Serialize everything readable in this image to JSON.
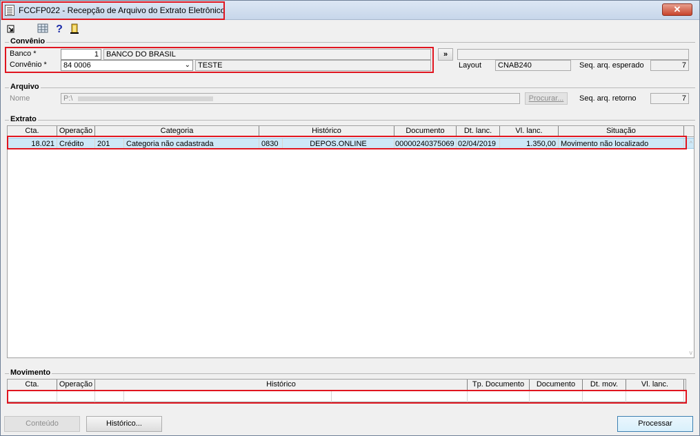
{
  "window": {
    "title": "FCCFP022 - Recepção de Arquivo do Extrato Eletrônico",
    "close_label": "✕"
  },
  "toolbar": {
    "items": [
      "exit-icon",
      "calculator-icon",
      "help-icon",
      "door-exit-icon"
    ]
  },
  "convenio": {
    "group_label": "Convênio",
    "banco_label": "Banco *",
    "banco_value": "1",
    "banco_name": "BANCO DO BRASIL",
    "convenio_label": "Convênio *",
    "convenio_value": "84           0006",
    "convenio_desc": "TESTE",
    "expand_button": "»",
    "layout_label": "Layout",
    "layout_value": "CNAB240",
    "seq_esperado_label": "Seq. arq. esperado",
    "seq_esperado_value": "7"
  },
  "arquivo": {
    "group_label": "Arquivo",
    "nome_label": "Nome",
    "nome_value": "P:\\",
    "procurar_button": "Procurar...",
    "seq_retorno_label": "Seq. arq. retorno",
    "seq_retorno_value": "7"
  },
  "extrato": {
    "group_label": "Extrato",
    "columns": [
      "Cta.",
      "Operação",
      "Categoria",
      "Histórico",
      "Documento",
      "Dt. lanc.",
      "Vl. lanc.",
      "Situação"
    ],
    "rows": [
      {
        "cta": "18.021",
        "operacao": "Crédito",
        "cat_code": "201",
        "categoria": "Categoria não cadastrada",
        "hist_code": "0830",
        "historico": "DEPOS.ONLINE",
        "documento": "00000240375069",
        "dt_lanc": "02/04/2019",
        "vl_lanc": "1.350,00",
        "situacao": "Movimento não localizado"
      }
    ]
  },
  "movimento": {
    "group_label": "Movimento",
    "columns": [
      "Cta.",
      "Operação",
      "Histórico",
      "Tp. Documento",
      "Documento",
      "Dt. mov.",
      "Vl. lanc."
    ]
  },
  "footer": {
    "conteudo_button": "Conteúdo",
    "historico_button": "Histórico...",
    "processar_button": "Processar"
  },
  "colors": {
    "highlight": "#e0141e",
    "selected_row": "#cde8f7",
    "window_bg": "#f0f0f0"
  }
}
